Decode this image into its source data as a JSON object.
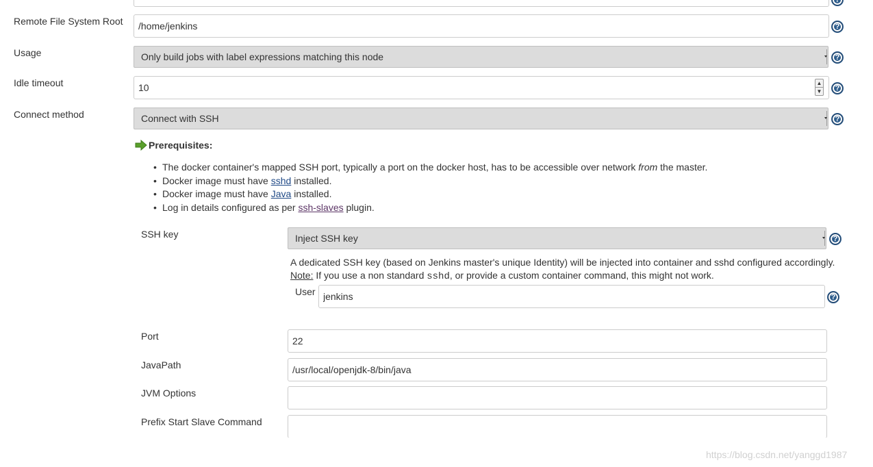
{
  "form": {
    "remote_fs_root": {
      "label": "Remote File System Root",
      "value": "/home/jenkins"
    },
    "usage": {
      "label": "Usage",
      "selected": "Only build jobs with label expressions matching this node"
    },
    "idle_timeout": {
      "label": "Idle timeout",
      "value": "10"
    },
    "connect_method": {
      "label": "Connect method",
      "selected": "Connect with SSH"
    }
  },
  "prerequisites": {
    "title": "Prerequisites:",
    "items": {
      "0": {
        "before": "The docker container's mapped SSH port, typically a port on the docker host, has to be accessible over network ",
        "em": "from",
        "after": " the master."
      },
      "1": {
        "before": "Docker image must have ",
        "link": "sshd",
        "after": " installed."
      },
      "2": {
        "before": "Docker image must have ",
        "link": "Java",
        "after": " installed."
      },
      "3": {
        "before": "Log in details configured as per ",
        "link": "ssh-slaves",
        "after": " plugin."
      }
    }
  },
  "ssh": {
    "key_label": "SSH key",
    "key_selected": "Inject SSH key",
    "description": "A dedicated SSH key (based on Jenkins master's unique Identity) will be injected into container and sshd configured accordingly.",
    "note_label": "Note:",
    "note_before": " If you use a non standard ",
    "note_code": "sshd",
    "note_after": ", or provide a custom container command, this might not work.",
    "user_label": "User",
    "user_value": "jenkins"
  },
  "advanced": {
    "port": {
      "label": "Port",
      "value": "22"
    },
    "java_path": {
      "label": "JavaPath",
      "value": "/usr/local/openjdk-8/bin/java"
    },
    "jvm_options": {
      "label": "JVM Options",
      "value": ""
    },
    "prefix_start": {
      "label": "Prefix Start Slave Command",
      "value": ""
    }
  },
  "help_glyph": "?",
  "icons": {
    "help": "help-icon",
    "prerequisites": "green-arrow-icon"
  },
  "colors": {
    "link": "#204a87",
    "visited_link": "#5c3566",
    "help": "#2e5d8c",
    "select_bg": "#dcdcdc",
    "arrow": "#5aa02c"
  },
  "watermark": "https://blog.csdn.net/yanggd1987"
}
